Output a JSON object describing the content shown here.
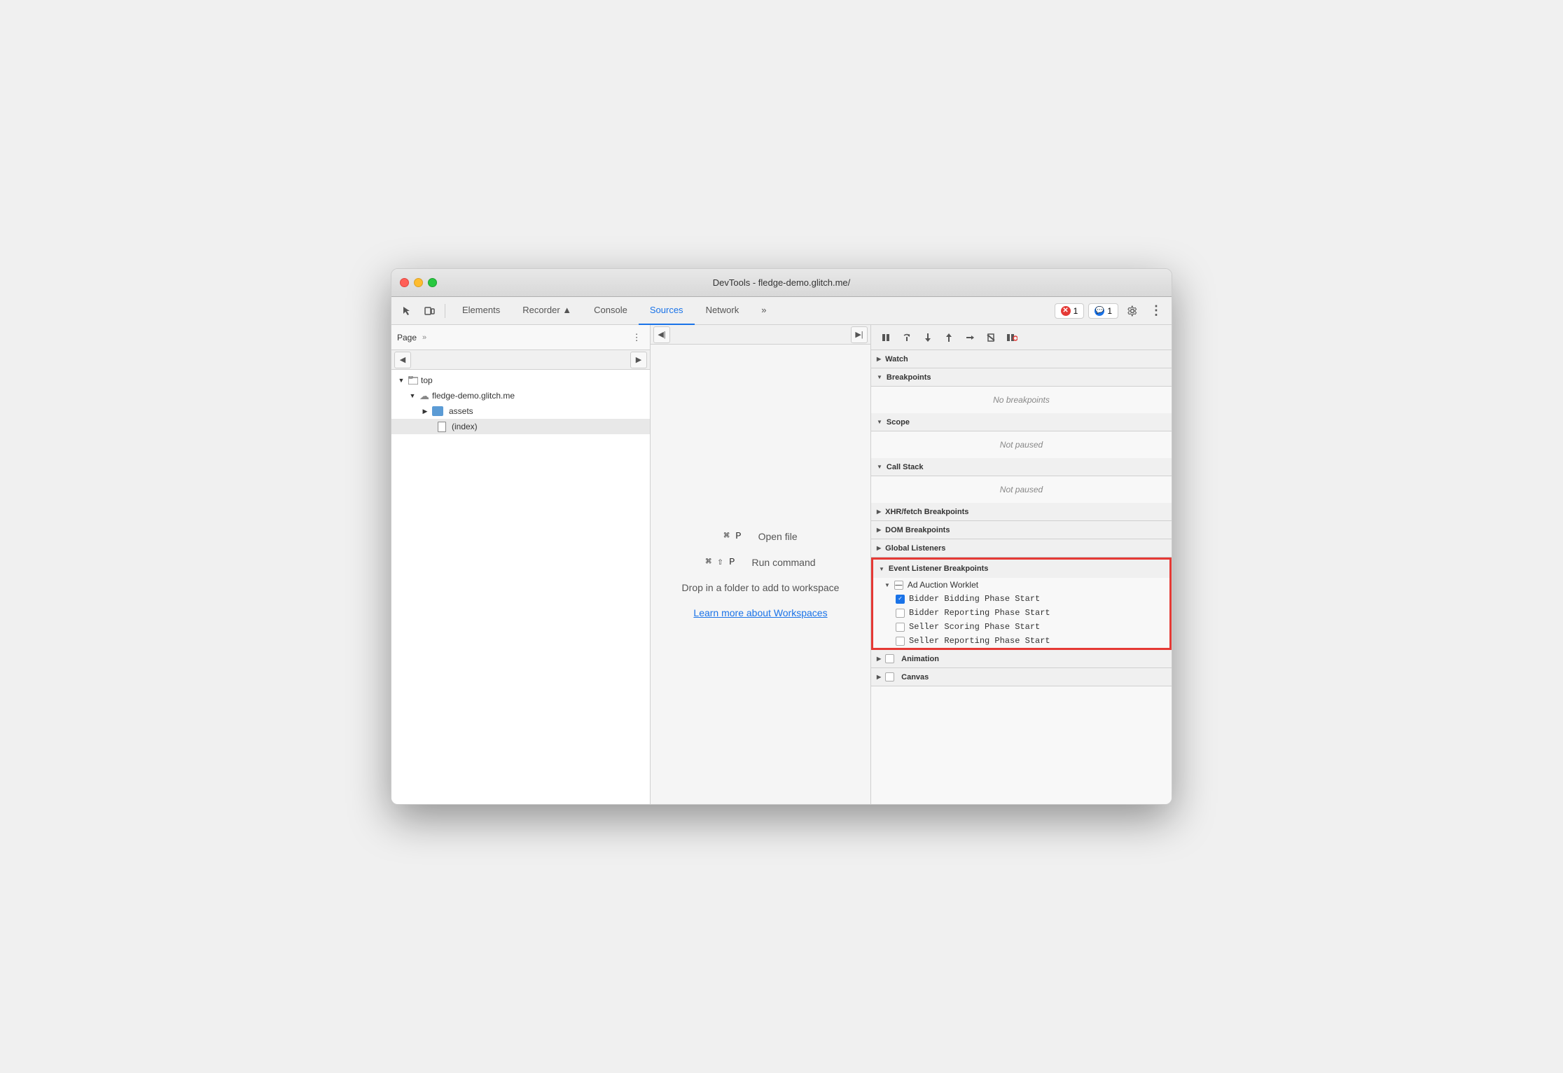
{
  "window": {
    "title": "DevTools - fledge-demo.glitch.me/"
  },
  "toolbar": {
    "tabs": [
      {
        "label": "Elements",
        "active": false
      },
      {
        "label": "Recorder ▲",
        "active": false
      },
      {
        "label": "Console",
        "active": false
      },
      {
        "label": "Sources",
        "active": true
      },
      {
        "label": "Network",
        "active": false
      },
      {
        "label": "»",
        "active": false
      }
    ],
    "error_badge": "1",
    "info_badge": "1"
  },
  "left_panel": {
    "tab_label": "Page",
    "tree": [
      {
        "label": "top",
        "level": 0,
        "type": "root",
        "expanded": true
      },
      {
        "label": "fledge-demo.glitch.me",
        "level": 1,
        "type": "cloud",
        "expanded": true
      },
      {
        "label": "assets",
        "level": 2,
        "type": "folder",
        "expanded": false
      },
      {
        "label": "(index)",
        "level": 2,
        "type": "file",
        "selected": true
      }
    ]
  },
  "center_panel": {
    "shortcut1_keys": "⌘ P",
    "shortcut1_label": "Open file",
    "shortcut2_keys": "⌘ ⇧ P",
    "shortcut2_label": "Run command",
    "workspace_text": "Drop in a folder to add to workspace",
    "workspace_link": "Learn more about Workspaces"
  },
  "right_panel": {
    "sections": [
      {
        "id": "watch",
        "label": "Watch",
        "expanded": false,
        "items": []
      },
      {
        "id": "breakpoints",
        "label": "Breakpoints",
        "expanded": true,
        "empty_text": "No breakpoints"
      },
      {
        "id": "scope",
        "label": "Scope",
        "expanded": true,
        "empty_text": "Not paused"
      },
      {
        "id": "call-stack",
        "label": "Call Stack",
        "expanded": true,
        "empty_text": "Not paused"
      },
      {
        "id": "xhr-fetch",
        "label": "XHR/fetch Breakpoints",
        "expanded": false
      },
      {
        "id": "dom-breakpoints",
        "label": "DOM Breakpoints",
        "expanded": false
      },
      {
        "id": "global-listeners",
        "label": "Global Listeners",
        "expanded": false
      },
      {
        "id": "event-listener-breakpoints",
        "label": "Event Listener Breakpoints",
        "expanded": true,
        "highlighted": true,
        "groups": [
          {
            "id": "ad-auction-worklet",
            "label": "Ad Auction Worklet",
            "expanded": true,
            "checkbox_state": "indeterminate",
            "items": [
              {
                "label": "Bidder Bidding Phase Start",
                "checked": true
              },
              {
                "label": "Bidder Reporting Phase Start",
                "checked": false
              },
              {
                "label": "Seller Scoring Phase Start",
                "checked": false
              },
              {
                "label": "Seller Reporting Phase Start",
                "checked": false
              }
            ]
          }
        ]
      },
      {
        "id": "animation",
        "label": "Animation",
        "expanded": false,
        "checkbox_state": "unchecked"
      },
      {
        "id": "canvas",
        "label": "Canvas",
        "expanded": false,
        "checkbox_state": "unchecked"
      }
    ]
  },
  "icons": {
    "pause": "⏸",
    "resume": "▶",
    "step_over": "↷",
    "step_into": "↓",
    "step_out": "↑",
    "step": "→",
    "deactivate": "⊘",
    "no_paused": "⏸"
  }
}
